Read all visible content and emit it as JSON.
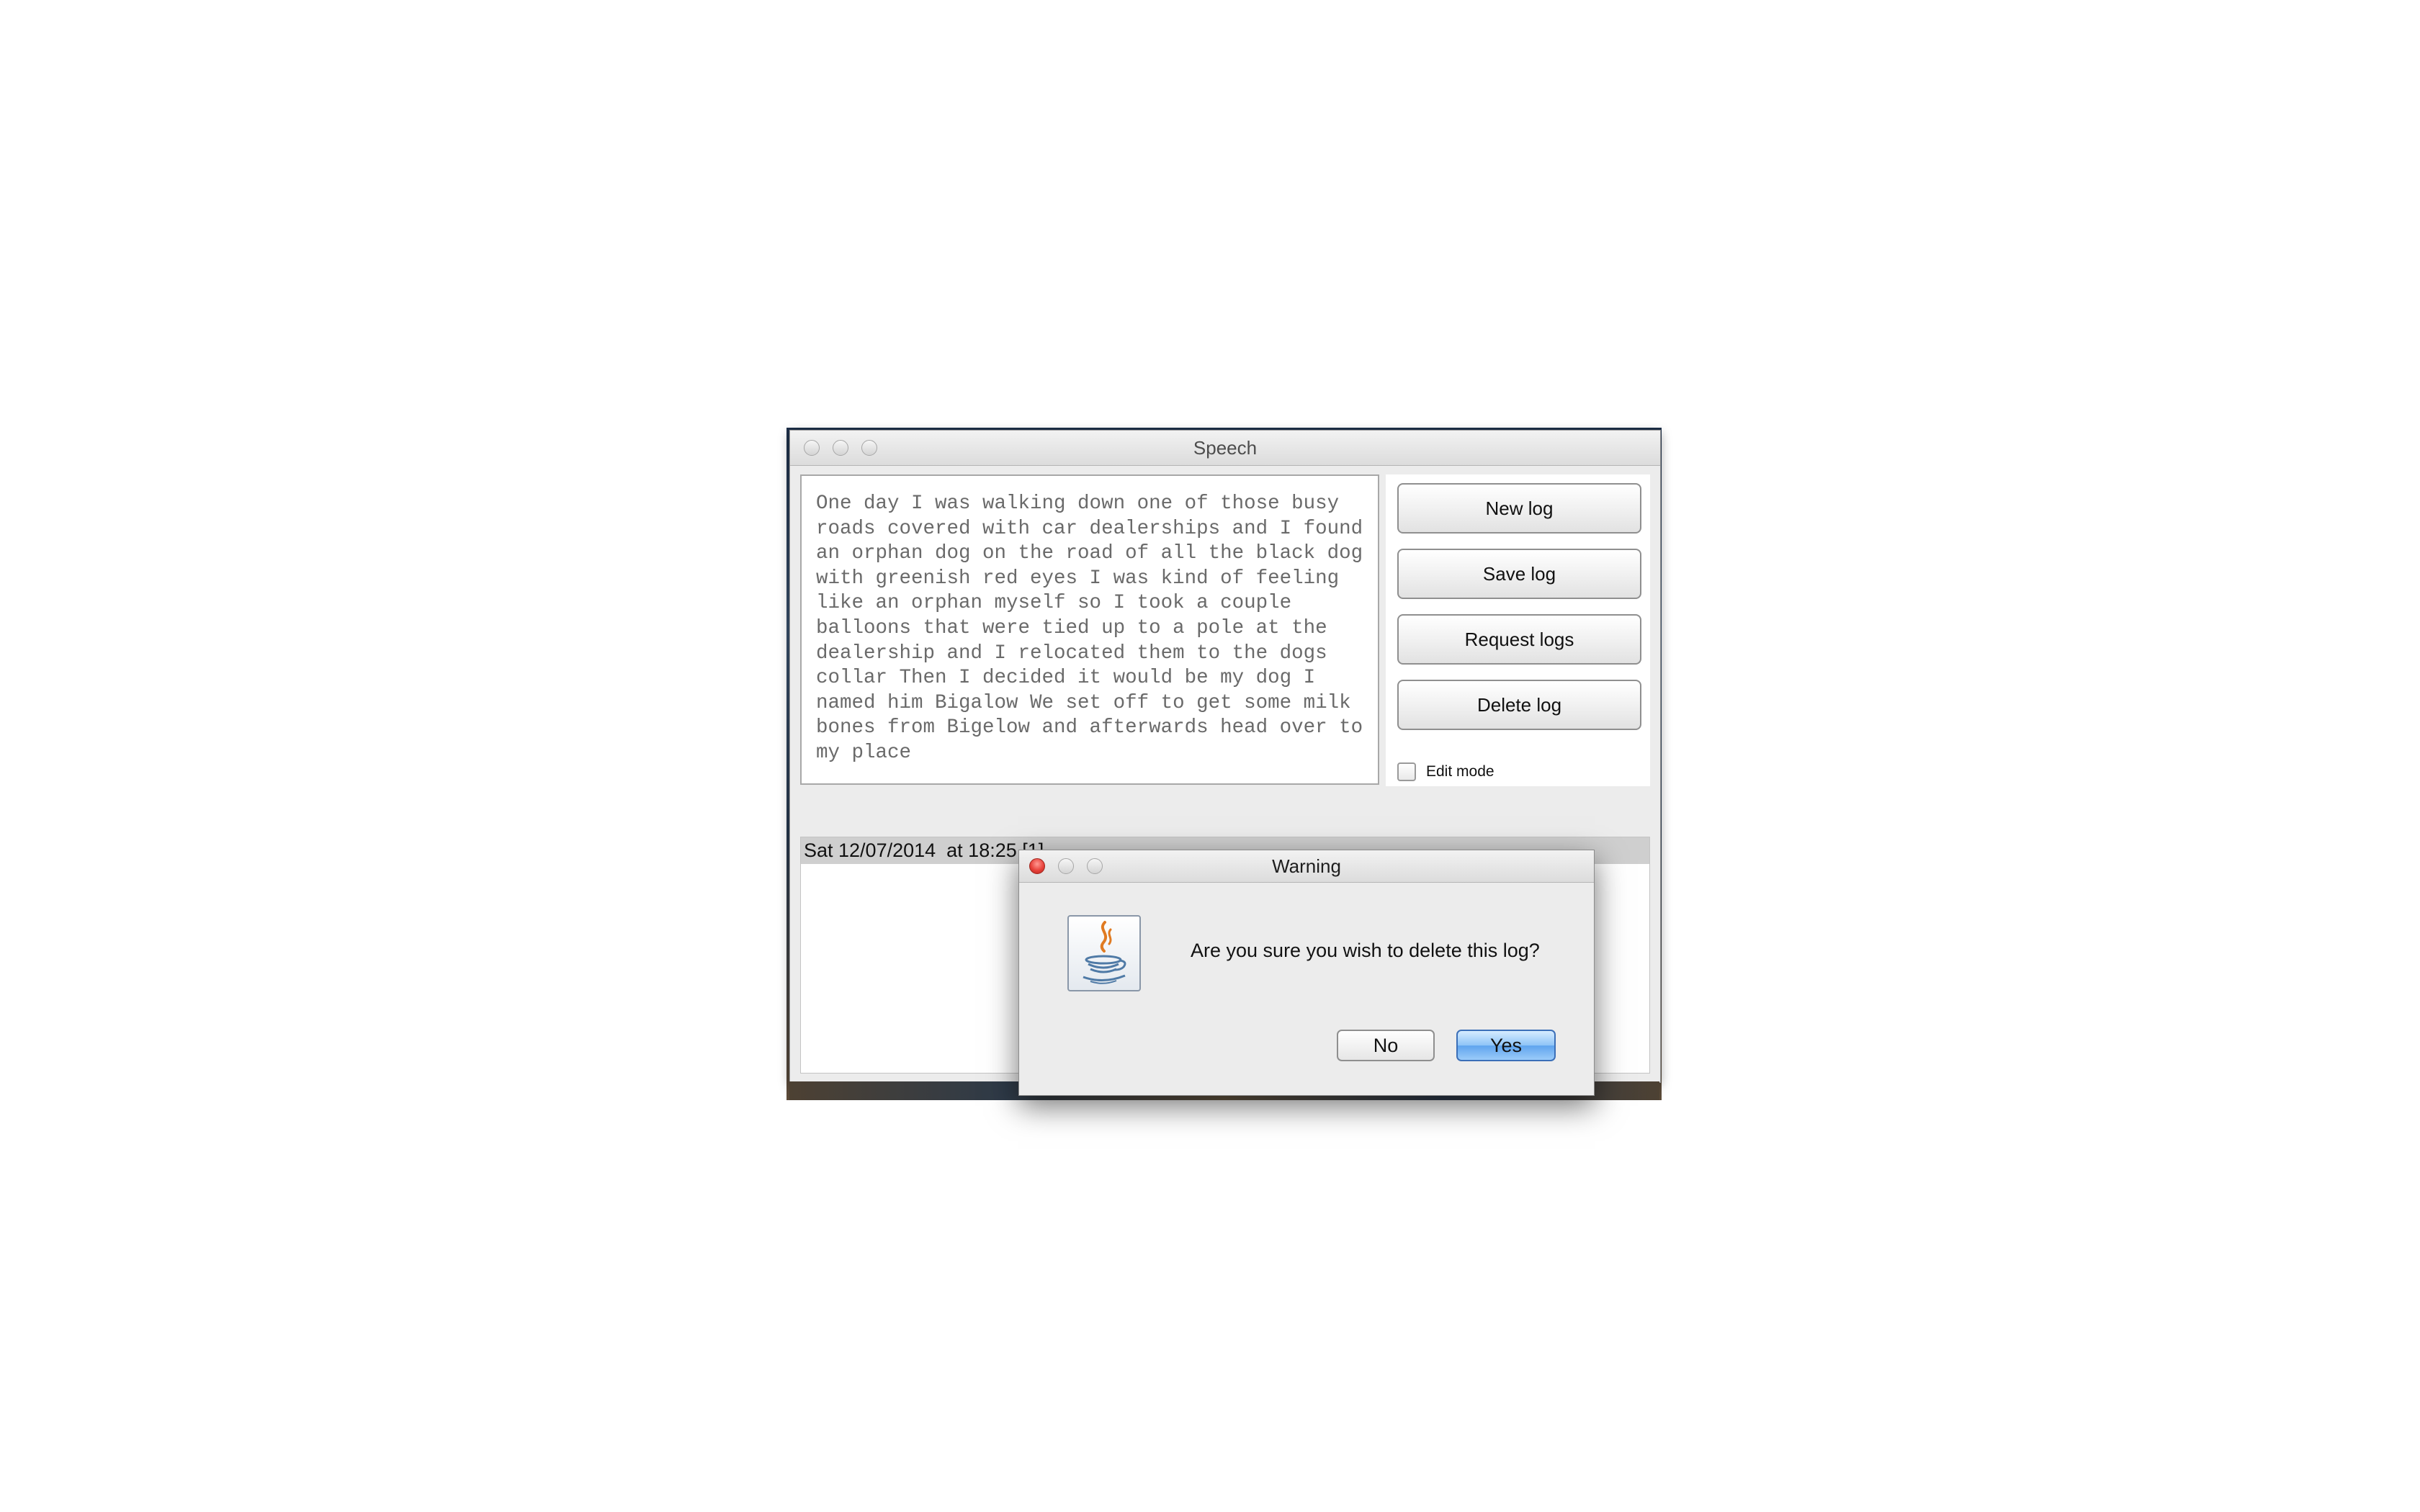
{
  "main_window": {
    "title": "Speech",
    "transcript_text": "One day I was walking down one of those busy roads covered with car dealerships and I found an orphan dog on the road of all the black dog with greenish red eyes I was kind of feeling like an orphan myself so I took a couple balloons that were tied up to a pole at the dealership and I relocated them to the dogs collar Then I decided it would be my dog I named him Bigalow We set off to get some milk bones from Bigelow and afterwards head over to my place",
    "buttons": {
      "new_log": "New log",
      "save_log": "Save log",
      "request_logs": "Request logs",
      "delete_log": "Delete log"
    },
    "edit_mode_label": "Edit mode",
    "edit_mode_checked": false,
    "logs": [
      {
        "label": "Sat 12/07/2014  at 18:25 [1]"
      }
    ]
  },
  "dialog": {
    "title": "Warning",
    "message": "Are you sure you wish to delete this log?",
    "no_label": "No",
    "yes_label": "Yes",
    "icon": "java-icon"
  },
  "colors": {
    "default_button_accent": "#5fa4ee",
    "close_button": "#e8413a",
    "selected_row": "#cfcfcf"
  }
}
